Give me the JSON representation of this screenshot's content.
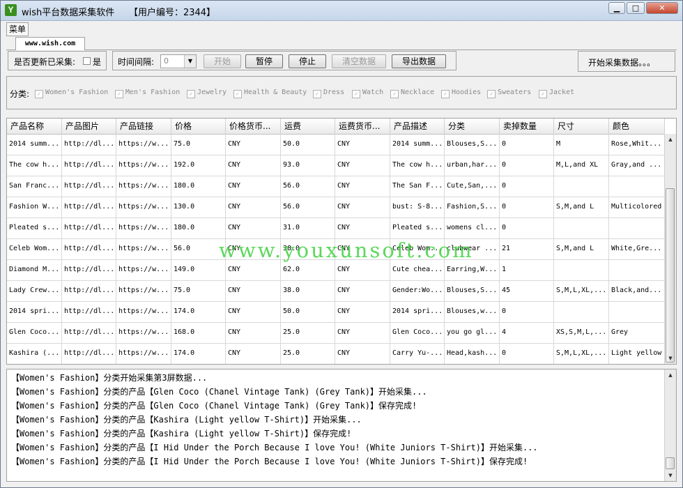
{
  "window": {
    "title": "wish平台数据采集软件",
    "user_id_label": "【用户编号：2344】",
    "minimize": "▁",
    "maximize": "□",
    "close": "✕"
  },
  "menu": {
    "label": "菜单"
  },
  "tab": {
    "label": "www.wish.com"
  },
  "toolbar": {
    "update_label": "是否更新已采集:",
    "update_checkbox_label": "是",
    "interval_label": "时间间隔:",
    "interval_value": "0",
    "start_label": "开始",
    "pause_label": "暂停",
    "stop_label": "停止",
    "clear_label": "清空数据",
    "export_label": "导出数据",
    "status_text": "开始采集数据。。。"
  },
  "categories": {
    "label": "分类:",
    "items": [
      "Women's Fashion",
      "Men's Fashion",
      "Jewelry",
      "Health & Beauty",
      "Dress",
      "Watch",
      "Necklace",
      "Hoodies",
      "Sweaters",
      "Jacket"
    ]
  },
  "table": {
    "columns": [
      "产品名称",
      "产品图片",
      "产品链接",
      "价格",
      "价格货币...",
      "运费",
      "运费货币...",
      "产品描述",
      "分类",
      "卖掉数量",
      "尺寸",
      "颜色"
    ],
    "rows": [
      [
        "2014 summ...",
        "http://dl...",
        "https://w...",
        "75.0",
        "CNY",
        "50.0",
        "CNY",
        "2014 summ...",
        "Blouses,S...",
        "0",
        "M",
        "Rose,Whit..."
      ],
      [
        "The cow h...",
        "http://dl...",
        "https://w...",
        "192.0",
        "CNY",
        "93.0",
        "CNY",
        "The cow h...",
        "urban,har...",
        "0",
        "M,L,and XL",
        "Gray,and ..."
      ],
      [
        "San Franc...",
        "http://dl...",
        "https://w...",
        "180.0",
        "CNY",
        "56.0",
        "CNY",
        "The San F...",
        "Cute,San,...",
        "0",
        "",
        ""
      ],
      [
        "Fashion W...",
        "http://dl...",
        "https://w...",
        "130.0",
        "CNY",
        "56.0",
        "CNY",
        "bust: S-8...",
        "Fashion,S...",
        "0",
        "S,M,and L",
        "Multicolored"
      ],
      [
        "Pleated s...",
        "http://dl...",
        "https://w...",
        "180.0",
        "CNY",
        "31.0",
        "CNY",
        "Pleated s...",
        "womens cl...",
        "0",
        "",
        ""
      ],
      [
        "Celeb Wom...",
        "http://dl...",
        "https://w...",
        "56.0",
        "CNY",
        "38.0",
        "CNY",
        "Celeb Wom...",
        "clubwear ...",
        "21",
        "S,M,and L",
        "White,Gre..."
      ],
      [
        "Diamond M...",
        "http://dl...",
        "https://w...",
        "149.0",
        "CNY",
        "62.0",
        "CNY",
        "Cute chea...",
        "Earring,W...",
        "1",
        "",
        ""
      ],
      [
        "Lady Crew...",
        "http://dl...",
        "https://w...",
        "75.0",
        "CNY",
        "38.0",
        "CNY",
        "Gender:Wo...",
        "Blouses,S...",
        "45",
        "S,M,L,XL,...",
        "Black,and..."
      ],
      [
        "2014 spri...",
        "http://dl...",
        "https://w...",
        "174.0",
        "CNY",
        "50.0",
        "CNY",
        "2014 spri...",
        "Blouses,w...",
        "0",
        "",
        ""
      ],
      [
        "Glen Coco...",
        "http://dl...",
        "https://w...",
        "168.0",
        "CNY",
        "25.0",
        "CNY",
        "Glen Coco...",
        "you go gl...",
        "4",
        "XS,S,M,L,...",
        "Grey"
      ],
      [
        "Kashira (...",
        "http://dl...",
        "https://w...",
        "174.0",
        "CNY",
        "25.0",
        "CNY",
        "Carry Yu-...",
        "Head,kash...",
        "0",
        "S,M,L,XL,...",
        "Light yellow"
      ]
    ]
  },
  "watermark": "www.youxunsoft.com",
  "log": [
    "【Women's Fashion】分类开始采集第3屏数据...",
    "【Women's Fashion】分类的产品【Glen Coco (Chanel Vintage Tank) (Grey Tank)】开始采集...",
    "【Women's Fashion】分类的产品【Glen Coco (Chanel Vintage Tank) (Grey Tank)】保存完成!",
    "【Women's Fashion】分类的产品【Kashira (Light yellow T-Shirt)】开始采集...",
    "【Women's Fashion】分类的产品【Kashira (Light yellow T-Shirt)】保存完成!",
    "【Women's Fashion】分类的产品【I Hid Under the Porch Because I love You! (White Juniors T-Shirt)】开始采集...",
    "【Women's Fashion】分类的产品【I Hid Under the Porch Because I love You! (White Juniors T-Shirt)】保存完成!"
  ]
}
